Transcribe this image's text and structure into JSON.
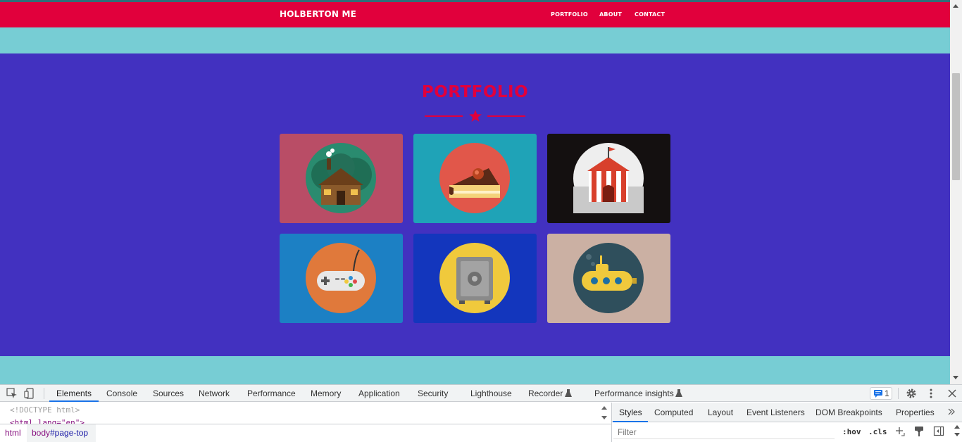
{
  "navbar": {
    "brand": "HOLBERTON ME",
    "links": [
      "PORTFOLIO",
      "ABOUT",
      "CONTACT"
    ],
    "color": "#e1003c"
  },
  "portfolio": {
    "title": "PORTFOLIO",
    "background": "#4231c0",
    "items": [
      {
        "name": "cabin",
        "bg": "#b94d66",
        "circle": "#2a8b6f"
      },
      {
        "name": "cake",
        "bg": "#1fa3b7",
        "circle": "#e1574a"
      },
      {
        "name": "circus",
        "bg": "#141010",
        "circle": "#eeeeee"
      },
      {
        "name": "game-controller",
        "bg": "#1c80c4",
        "circle": "#e0793b"
      },
      {
        "name": "safe",
        "bg": "#1336bd",
        "circle": "#f0c93c"
      },
      {
        "name": "submarine",
        "bg": "#cbb0a3",
        "circle": "#2f4f5c"
      }
    ]
  },
  "devtools": {
    "tabs": [
      "Elements",
      "Console",
      "Sources",
      "Network",
      "Performance",
      "Memory",
      "Application",
      "Security",
      "Lighthouse",
      "Recorder",
      "Performance insights"
    ],
    "active_tab": "Elements",
    "issues_count": "1",
    "code_lines": [
      "<!DOCTYPE html>",
      "<html lang=\"en\">"
    ],
    "breadcrumbs": {
      "html": "html",
      "body_tag": "body",
      "body_id": "#page-top"
    },
    "styles_tabs": [
      "Styles",
      "Computed",
      "Layout",
      "Event Listeners",
      "DOM Breakpoints",
      "Properties"
    ],
    "filter_placeholder": "Filter",
    "hov": ":hov",
    "cls": ".cls"
  }
}
